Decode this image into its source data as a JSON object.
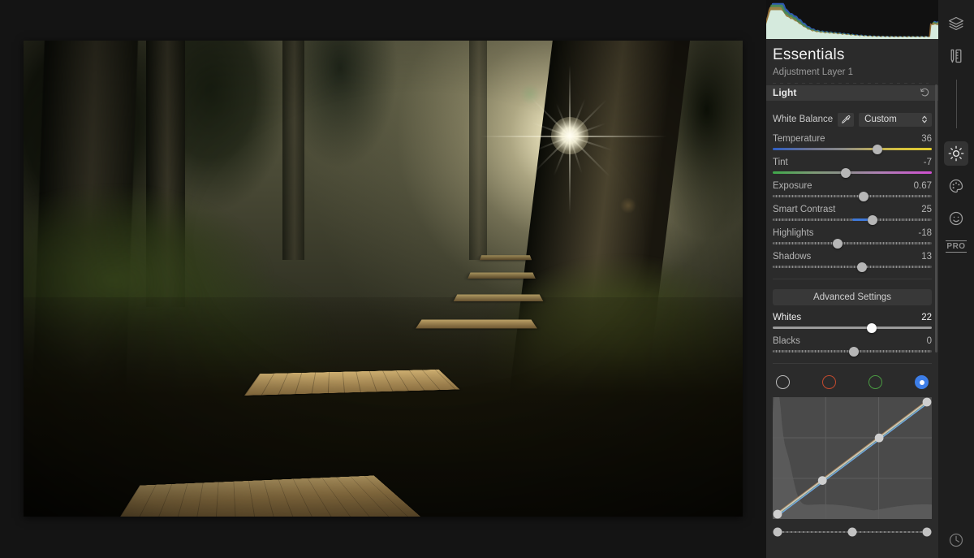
{
  "app": {
    "panel_title": "Essentials",
    "panel_subtitle": "Adjustment Layer 1"
  },
  "histogram": {
    "name": "rgb-histogram"
  },
  "section": {
    "title": "Light",
    "reset_icon": "reset-arrow-icon"
  },
  "white_balance": {
    "label": "White Balance",
    "eyedropper_icon": "eyedropper-icon",
    "value": "Custom",
    "chevron_icon": "chevron-updown-icon",
    "options": [
      "Custom"
    ]
  },
  "sliders": [
    {
      "label": "Temperature",
      "value": "36",
      "pos": 66,
      "style": "temp",
      "name": "temperature"
    },
    {
      "label": "Tint",
      "value": "-7",
      "pos": 46,
      "style": "tint",
      "name": "tint"
    },
    {
      "label": "Exposure",
      "value": "0.67",
      "pos": 57,
      "style": "dotted",
      "name": "exposure"
    },
    {
      "label": "Smart Contrast",
      "value": "25",
      "pos": 63,
      "style": "dotted",
      "name": "smart-contrast",
      "fill_from": 50,
      "fill_color": "#3f78d8"
    },
    {
      "label": "Highlights",
      "value": "-18",
      "pos": 41,
      "style": "dotted",
      "name": "highlights"
    },
    {
      "label": "Shadows",
      "value": "13",
      "pos": 56,
      "style": "dotted",
      "name": "shadows"
    }
  ],
  "advanced": {
    "label": "Advanced Settings"
  },
  "sliders_advanced": [
    {
      "label": "Whites",
      "value": "22",
      "pos": 62,
      "style": "bright",
      "name": "whites",
      "active": true
    },
    {
      "label": "Blacks",
      "value": "0",
      "pos": 51,
      "style": "dotted",
      "name": "blacks",
      "active": false
    }
  ],
  "channels": [
    {
      "name": "channel-rgb",
      "color": "#bbbbbb",
      "selected": false
    },
    {
      "name": "channel-red",
      "color": "#c24a2e",
      "selected": false
    },
    {
      "name": "channel-green",
      "color": "#4a9a42",
      "selected": false
    },
    {
      "name": "channel-blue",
      "color": "#3d7ee8",
      "selected": true
    }
  ],
  "curve": {
    "name": "tone-curve-editor",
    "points": [
      [
        0,
        0
      ],
      [
        30,
        30
      ],
      [
        68,
        68
      ],
      [
        100,
        100
      ]
    ],
    "strip_points": [
      0,
      50,
      100
    ]
  },
  "toolbar": [
    {
      "name": "layers-icon",
      "label": "Layers",
      "active": false
    },
    {
      "name": "tools-icon",
      "label": "Tools",
      "active": false
    },
    {
      "name": "brightness-icon",
      "label": "Light",
      "active": true
    },
    {
      "name": "palette-icon",
      "label": "Color",
      "active": false
    },
    {
      "name": "portrait-icon",
      "label": "Portrait",
      "active": false
    },
    {
      "name": "pro-badge",
      "label": "PRO",
      "active": false
    },
    {
      "name": "history-icon",
      "label": "History",
      "active": false
    }
  ],
  "colors": {
    "panel_bg": "#2b2b2b",
    "canvas_bg": "#141414",
    "toolbar_bg": "#1e1e1e",
    "accent_blue": "#3d7ee8",
    "section_bg": "#3a3a3a"
  }
}
